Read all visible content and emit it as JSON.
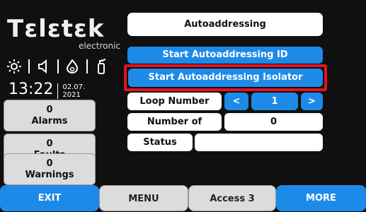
{
  "brand": {
    "name": "Τεlεtεk",
    "sub": "electronic"
  },
  "clock": {
    "time": "13:22",
    "date_line1": "02.07.",
    "date_line2": "2021"
  },
  "counters": [
    {
      "count": "0",
      "label": "Alarms"
    },
    {
      "count": "0",
      "label": "Faults"
    },
    {
      "count": "0",
      "label": "Warnings"
    }
  ],
  "main": {
    "title": "Autoaddressing",
    "start_id_label": "Start Autoaddressing ID",
    "start_isolator_label": "Start Autoaddressing Isolator",
    "loop_number_label": "Loop Number",
    "loop_prev": "<",
    "loop_value": "1",
    "loop_next": ">",
    "devices_label": "Number of Devices",
    "devices_value": "0",
    "status_label": "Status",
    "status_value": ""
  },
  "bottom_bar": {
    "exit_label": "EXIT",
    "menu_label": "MENU",
    "access_label": "Access 3",
    "more_label": "MORE"
  },
  "colors": {
    "accent_blue": "#1e8ae8",
    "highlight_red": "#e8101e",
    "background": "#101010"
  }
}
